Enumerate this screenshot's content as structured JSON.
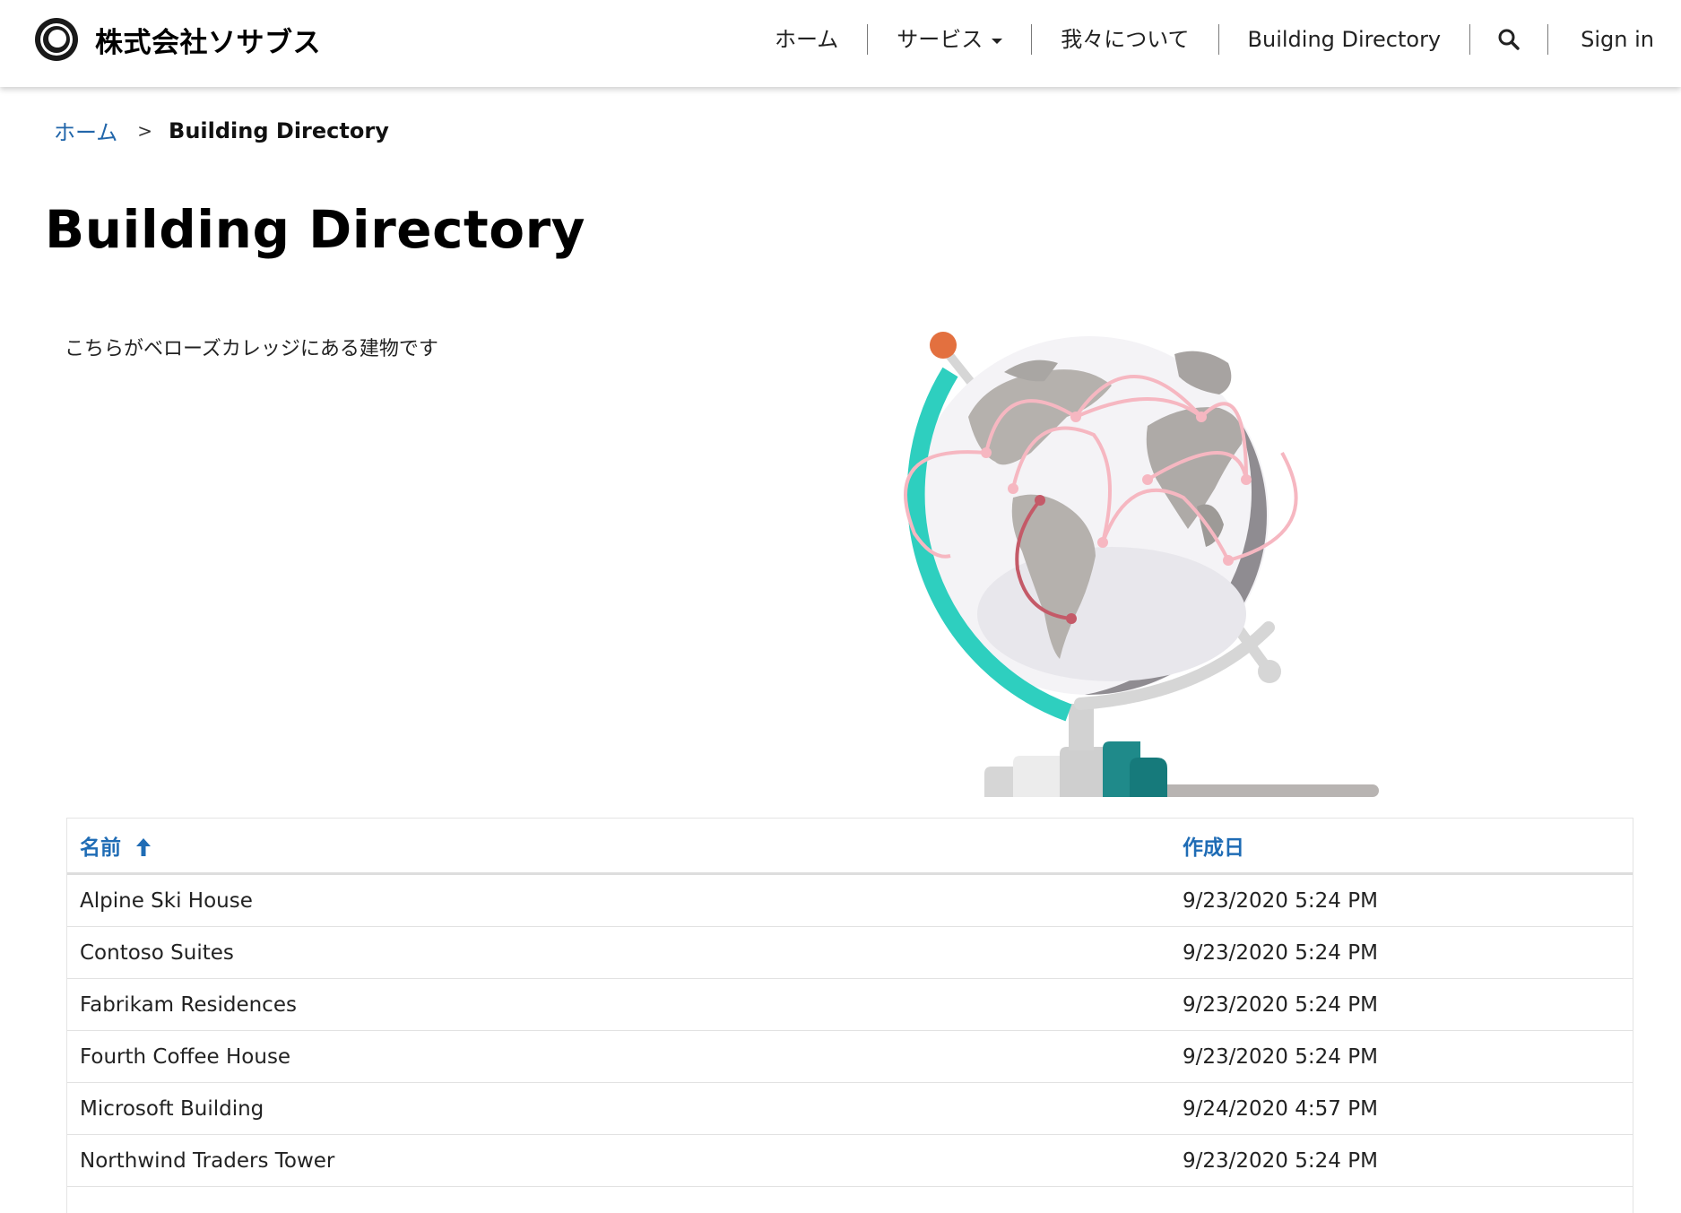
{
  "brand": {
    "name": "株式会社ソサブス",
    "logo_icon": "ring-logo-icon"
  },
  "nav": {
    "home": "ホーム",
    "services": "サービス",
    "about": "我々について",
    "directory": "Building Directory",
    "search_icon": "search-icon",
    "signin": "Sign in"
  },
  "breadcrumb": {
    "home": "ホーム",
    "separator": ">",
    "current": "Building Directory"
  },
  "page": {
    "title": "Building Directory",
    "intro": "こちらがベローズカレッジにある建物です"
  },
  "table": {
    "columns": [
      {
        "label": "名前",
        "sort": "ascending",
        "sort_icon": "arrow-up-icon"
      },
      {
        "label": "作成日"
      }
    ],
    "rows": [
      {
        "name": "Alpine Ski House",
        "created": "9/23/2020 5:24 PM"
      },
      {
        "name": "Contoso Suites",
        "created": "9/23/2020 5:24 PM"
      },
      {
        "name": "Fabrikam Residences",
        "created": "9/23/2020 5:24 PM"
      },
      {
        "name": "Fourth Coffee House",
        "created": "9/23/2020 5:24 PM"
      },
      {
        "name": "Microsoft Building",
        "created": "9/24/2020 4:57 PM"
      },
      {
        "name": "Northwind Traders Tower",
        "created": "9/23/2020 5:24 PM"
      }
    ]
  },
  "colors": {
    "link": "#2266aa",
    "header_link": "#1f6cb5",
    "accent_teal": "#2ecfbf"
  }
}
